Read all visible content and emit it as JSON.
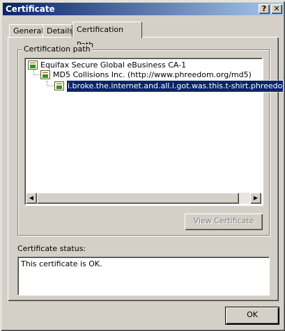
{
  "window": {
    "title": "Certificate",
    "help_label": "?",
    "close_label": "✕"
  },
  "tabs": [
    {
      "label": "General",
      "active": false
    },
    {
      "label": "Details",
      "active": false
    },
    {
      "label": "Certification Path",
      "active": true
    }
  ],
  "cert_path": {
    "label": "Certification path",
    "nodes": [
      {
        "label": "Equifax Secure Global eBusiness CA-1",
        "icon": "certificate-icon"
      },
      {
        "label": "MD5 Collisions Inc. (http://www.phreedom.org/md5)",
        "icon": "certificate-icon"
      },
      {
        "label": "i.broke.the.internet.and.all.i.got.was.this.t-shirt.phreedo",
        "icon": "certificate-icon",
        "selected": true
      }
    ],
    "view_button": "View Certificate"
  },
  "status": {
    "label": "Certificate status:",
    "text": "This certificate is OK."
  },
  "ok_label": "OK",
  "colors": {
    "titlebar": "#0a246a",
    "selection": "#0a246a",
    "face": "#d4d0c8"
  }
}
